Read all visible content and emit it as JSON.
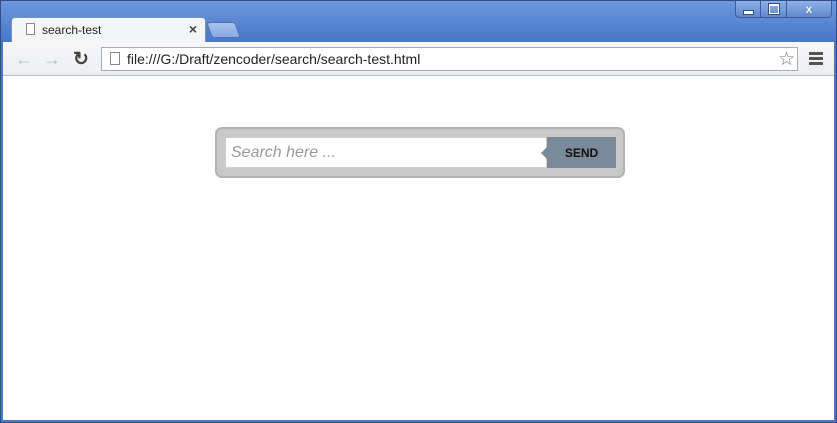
{
  "window": {
    "minimize_icon": "minimize-icon",
    "maximize_icon": "maximize-icon",
    "close_icon": "close-icon",
    "close_glyph": "x"
  },
  "tab": {
    "title": "search-test",
    "close_glyph": "×"
  },
  "toolbar": {
    "back_glyph": "←",
    "forward_glyph": "→",
    "reload_glyph": "↻",
    "url": "file:///G:/Draft/zencoder/search/search-test.html",
    "star_glyph": "☆"
  },
  "search": {
    "placeholder": "Search here ...",
    "value": "",
    "send_label": "SEND"
  },
  "colors": {
    "chrome_blue": "#4a78c6",
    "send_button": "#7a8a99",
    "search_frame": "#c9c9c9"
  }
}
